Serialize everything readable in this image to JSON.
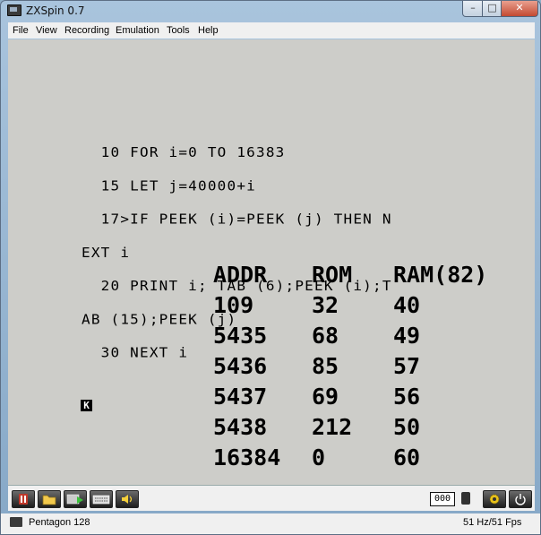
{
  "window": {
    "title": "ZXSpin 0.7"
  },
  "menu": [
    "File",
    "View",
    "Recording",
    "Emulation",
    "Tools",
    "Help"
  ],
  "program": {
    "lines": [
      "  10 FOR i=0 TO 16383",
      "  15 LET j=40000+i",
      "  17>IF PEEK (i)=PEEK (j) THEN N",
      "EXT i",
      "  20 PRINT i; TAB (6);PEEK (i);T",
      "AB (15);PEEK (j)",
      "  30 NEXT i"
    ]
  },
  "table": {
    "headers": [
      "ADDR",
      "ROM",
      "RAM(82)"
    ],
    "rows": [
      [
        "109",
        "32",
        "40"
      ],
      [
        "5435",
        "68",
        "49"
      ],
      [
        "5436",
        "85",
        "57"
      ],
      [
        "5437",
        "69",
        "56"
      ],
      [
        "5438",
        "212",
        "50"
      ],
      [
        "16384",
        "0",
        "60"
      ]
    ]
  },
  "cursor": "K",
  "toolbar": {
    "buttons": [
      "pause-icon",
      "open-folder-icon",
      "play-tape-icon",
      "keyboard-icon",
      "sound-icon"
    ],
    "counter": "000",
    "right_buttons": [
      "settings-gear-icon",
      "power-icon"
    ]
  },
  "status": {
    "model": "Pentagon 128",
    "fps": "51 Hz/51 Fps"
  },
  "colors": {
    "screen": "#cdcdc9",
    "pause_button": "#c0392b",
    "gear": "#e8c21a"
  }
}
